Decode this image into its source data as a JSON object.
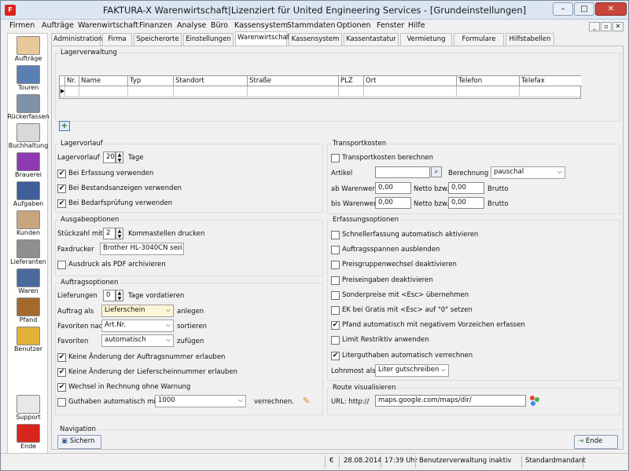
{
  "window": {
    "title": "FAKTURA-X Warenwirtschaft|Lizenziert für United Engineering Services - [Grundeinstellungen]",
    "app_icon_text": "F",
    "minimize_glyph": "–",
    "maximize_glyph": "□",
    "close_glyph": "✕"
  },
  "menu": [
    "Firmen",
    "Aufträge",
    "Warenwirtschaft",
    "Finanzen",
    "Analyse",
    "Büro",
    "Kassensystem",
    "Stammdaten",
    "Optionen",
    "Fenster",
    "Hilfe"
  ],
  "mdi_buttons": [
    "_",
    "▫",
    "✕"
  ],
  "sidebar": [
    {
      "label": "Aufträge",
      "color": "#e9c89c",
      "icon": "aufträge-icon"
    },
    {
      "label": "Touren",
      "color": "#5a7fb3",
      "icon": "truck-icon"
    },
    {
      "label": "Rückerfassen",
      "color": "#7f93a7",
      "icon": "return-truck-icon"
    },
    {
      "label": "Buchhaltung",
      "color": "#d9d9d9",
      "icon": "accounting-icon"
    },
    {
      "label": "Brauerei",
      "color": "#8e3ab3",
      "icon": "brewery-icon"
    },
    {
      "label": "Aufgaben",
      "color": "#3f5f9a",
      "icon": "tasks-icon"
    },
    {
      "label": "Kunden",
      "color": "#c9a57f",
      "icon": "customers-icon"
    },
    {
      "label": "Lieferanten",
      "color": "#8f8f8f",
      "icon": "suppliers-icon"
    },
    {
      "label": "Waren",
      "color": "#4a6a9c",
      "icon": "goods-icon"
    },
    {
      "label": "Pfand",
      "color": "#a46a2b",
      "icon": "deposit-icon"
    },
    {
      "label": "Benutzer",
      "color": "#e0b23a",
      "icon": "user-icon"
    },
    {
      "label": "Support",
      "color": "#e8e8e8",
      "icon": "support-icon"
    },
    {
      "label": "Ende",
      "color": "#d9261c",
      "icon": "power-icon"
    }
  ],
  "tabs": [
    "Administration",
    "Firma",
    "Speicherorte",
    "Einstellungen",
    "Warenwirtschaft",
    "Kassensystem",
    "Kassentastatur",
    "Vermietung",
    "Formulare",
    "Hilfstabellen"
  ],
  "active_tab": 4,
  "lagerverwaltung": {
    "title": "Lagerverwaltung",
    "columns": [
      "Nr.",
      "Name",
      "Typ",
      "Standort",
      "Straße",
      "PLZ",
      "Ort",
      "Telefon",
      "Telefax"
    ],
    "row_indicator": "▶",
    "add_icon": "+"
  },
  "lagervorlauf": {
    "title": "Lagervorlauf",
    "label": "Lagervorlauf",
    "value": "20",
    "unit": "Tage",
    "checks": [
      {
        "label": "Bei Erfassung verwenden",
        "checked": true
      },
      {
        "label": "Bei Bestandsanzeigen verwenden",
        "checked": true
      },
      {
        "label": "Bei Bedarfsprüfung verwenden",
        "checked": true
      }
    ]
  },
  "ausgabe": {
    "title": "Ausgabeoptionen",
    "stueck_label": "Stückzahl mit",
    "stueck_value": "2",
    "stueck_suffix": "Kommastellen drucken",
    "fax_label": "Faxdrucker",
    "fax_value": "Brother HL-3040CN seri",
    "pdf_label": "Ausdruck als PDF archivieren",
    "pdf_checked": false
  },
  "auftrag": {
    "title": "Auftragsoptionen",
    "lief_label": "Lieferungen",
    "lief_value": "0",
    "lief_suffix": "Tage vordatieren",
    "als_label": "Auftrag als",
    "als_value": "Lieferschein",
    "als_suffix": "anlegen",
    "fav_nach_label": "Favoriten nach",
    "fav_nach_value": "Art.Nr.",
    "fav_nach_suffix": "sortieren",
    "fav_label": "Favoriten",
    "fav_value": "automatisch",
    "fav_suffix": "zufügen",
    "checks": [
      {
        "label": "Keine Änderung der Auftragsnummer erlauben",
        "checked": true
      },
      {
        "label": "Keine Änderung der Lieferscheinnummer erlauben",
        "checked": true
      },
      {
        "label": "Wechsel in Rechnung ohne Warnung",
        "checked": true
      }
    ],
    "guthaben_label": "Guthaben automatisch mit",
    "guthaben_checked": false,
    "guthaben_value": "1000",
    "guthaben_suffix": "verrechnen."
  },
  "transport": {
    "title": "Transportkosten",
    "calc_label": "Transportkosten berechnen",
    "calc_checked": false,
    "artikel_label": "Artikel",
    "artikel_value": "",
    "berechnung_label": "Berechnung",
    "berechnung_value": "pauschal",
    "ab_label": "ab Warenwert",
    "ab_value": "0,00",
    "netto1_label": "Netto bzw.",
    "netto1_value": "0,00",
    "brutto1_label": "Brutto",
    "bis_label": "bis Warenwert",
    "bis_value": "0,00",
    "netto2_label": "Netto bzw.",
    "netto2_value": "0,00",
    "brutto2_label": "Brutto"
  },
  "erfassung": {
    "title": "Erfassungsoptionen",
    "checks": [
      {
        "label": "Schnellerfassung automatisch aktivieren",
        "checked": false
      },
      {
        "label": "Auftragsspannen ausblenden",
        "checked": false
      },
      {
        "label": "Preisgruppenwechsel deaktivieren",
        "checked": false
      },
      {
        "label": "Preiseingaben deaktivieren",
        "checked": false
      },
      {
        "label": "Sonderpreise mit <Esc> übernehmen",
        "checked": false
      },
      {
        "label": "EK bei Gratis mit <Esc> auf \"0\" setzen",
        "checked": false
      },
      {
        "label": "Pfand automatisch mit negativem Vorzeichen erfassen",
        "checked": true
      },
      {
        "label": "Limit Restriktiv anwenden",
        "checked": false
      },
      {
        "label": "Literguthaben automatisch verrechnen",
        "checked": true
      }
    ],
    "lohn_label": "Lohnmost als",
    "lohn_value": "Liter gutschreiben"
  },
  "route": {
    "title": "Route visualisieren",
    "url_label": "URL: http://",
    "url_value": "maps.google.com/maps/dir/"
  },
  "navigation": {
    "title": "Navigation",
    "save_label": "Sichern",
    "end_label": "Ende"
  },
  "status": {
    "currency": "€",
    "date": "28.08.2014",
    "time": "17:39 Uhr",
    "user_admin": "Benutzerverwaltung inaktiv",
    "mandant": "Standardmandant"
  },
  "colors": {
    "title_bg": "#dbe6f2",
    "accent_red": "#d9261c",
    "check_mark": "✔"
  }
}
